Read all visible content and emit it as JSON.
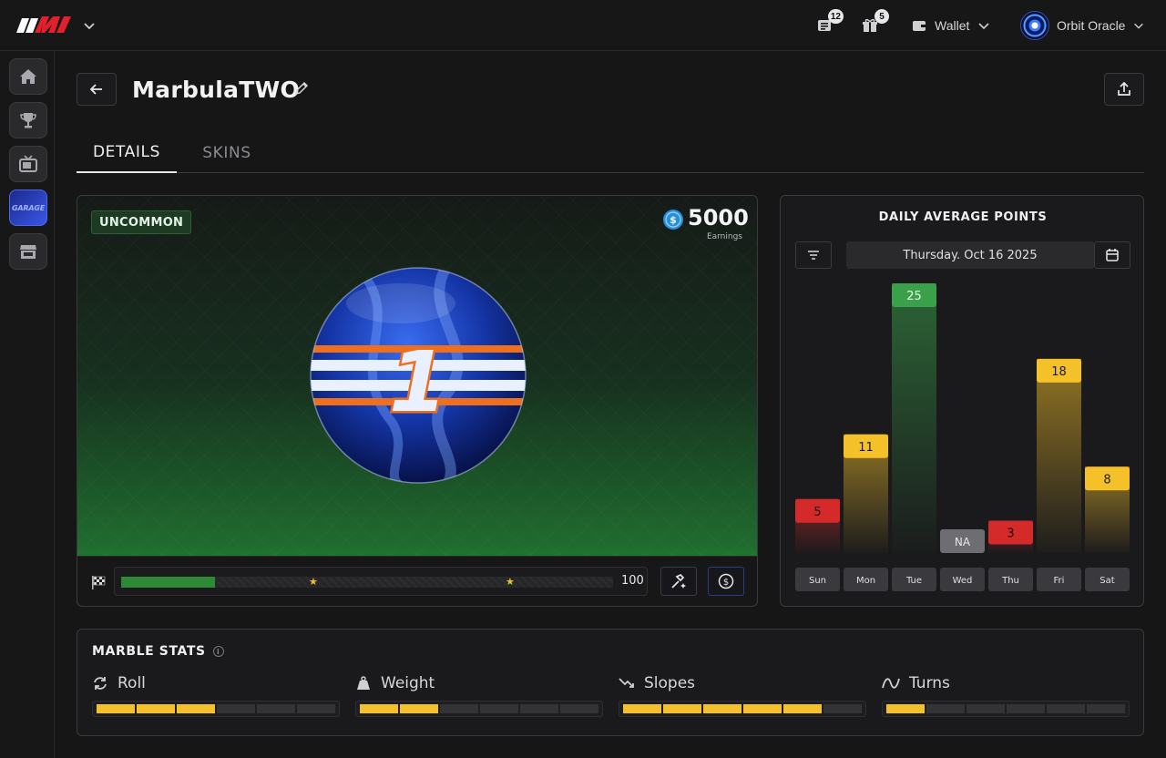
{
  "topbar": {
    "news_badge": "12",
    "gifts_badge": "5",
    "wallet_label": "Wallet",
    "user_name": "Orbit Oracle"
  },
  "sidebar": {
    "items": [
      {
        "name": "home",
        "icon": "home-icon"
      },
      {
        "name": "trophy",
        "icon": "trophy-icon"
      },
      {
        "name": "tv",
        "icon": "tv-icon"
      },
      {
        "name": "garage",
        "label": "GARAGE"
      },
      {
        "name": "store",
        "icon": "store-icon"
      }
    ]
  },
  "header": {
    "title": "MarbulaTWO"
  },
  "tabs": [
    {
      "label": "DETAILS",
      "active": true
    },
    {
      "label": "SKINS",
      "active": false
    }
  ],
  "marble": {
    "rarity": "UNCOMMON",
    "earnings_value": "5000",
    "earnings_label": "Earnings",
    "number": "1",
    "xp_value": "100",
    "xp_progress": 0.19,
    "xp_stars_at": [
      0.39,
      0.79
    ]
  },
  "chart_data": {
    "type": "bar",
    "title": "DAILY AVERAGE POINTS",
    "date": "Thursday. Oct 16 2025",
    "categories": [
      "Sun",
      "Mon",
      "Tue",
      "Wed",
      "Thu",
      "Fri",
      "Sat"
    ],
    "values": [
      5,
      11,
      25,
      null,
      3,
      18,
      8
    ],
    "labels": [
      "5",
      "11",
      "25",
      "NA",
      "3",
      "18",
      "8"
    ],
    "ylim": [
      0,
      25
    ],
    "colors": {
      "low": "#d42a2a",
      "mid": "#f5c12a",
      "high": "#3aa14a",
      "na": "#6e6e72"
    }
  },
  "stats": {
    "title": "MARBLE STATS",
    "items": [
      {
        "label": "Roll",
        "icon": "roll-icon",
        "value": 3,
        "max": 6
      },
      {
        "label": "Weight",
        "icon": "weight-icon",
        "value": 2,
        "max": 6
      },
      {
        "label": "Slopes",
        "icon": "slopes-icon",
        "value": 5,
        "max": 6
      },
      {
        "label": "Turns",
        "icon": "turns-icon",
        "value": 1,
        "max": 6
      }
    ]
  },
  "colors": {
    "accent": "#3a57e8",
    "xp_fill": "#2e8a36",
    "stat_fill": "#f5c12a"
  }
}
